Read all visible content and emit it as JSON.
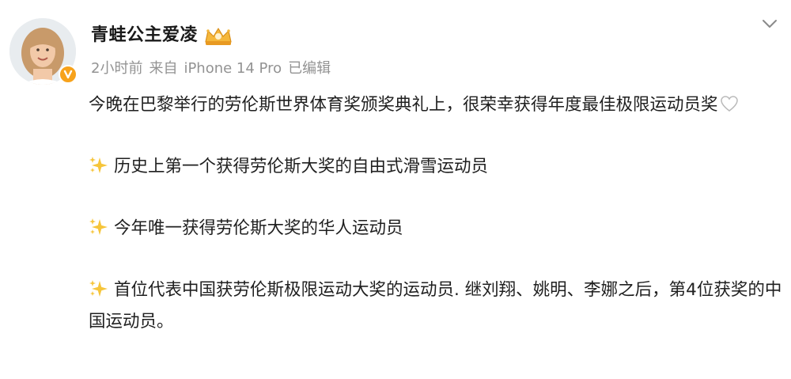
{
  "post": {
    "author": {
      "name": "青蛙公主爱凌",
      "avatar_icon": "user-avatar",
      "verified_badge_color": "#f7a21b",
      "member_badge_icon": "crown-member-icon"
    },
    "meta": {
      "time": "2小时前",
      "source_prefix": "来自",
      "source": "iPhone 14 Pro",
      "edited": "已编辑"
    },
    "menu_icon": "chevron-down-icon",
    "body": {
      "intro": "今晚在巴黎举行的劳伦斯世界体育奖颁奖典礼上，很荣幸获得年度最佳极限运动员奖",
      "intro_emoji": "heart-icon",
      "points": [
        {
          "icon": "sparkles-icon",
          "text": "历史上第一个获得劳伦斯大奖的自由式滑雪运动员"
        },
        {
          "icon": "sparkles-icon",
          "text": "今年唯一获得劳伦斯大奖的华人运动员"
        },
        {
          "icon": "sparkles-icon",
          "text": "首位代表中国获劳伦斯极限运动大奖的运动员. 继刘翔、姚明、李娜之后，第4位获奖的中国运动员。"
        }
      ]
    }
  }
}
